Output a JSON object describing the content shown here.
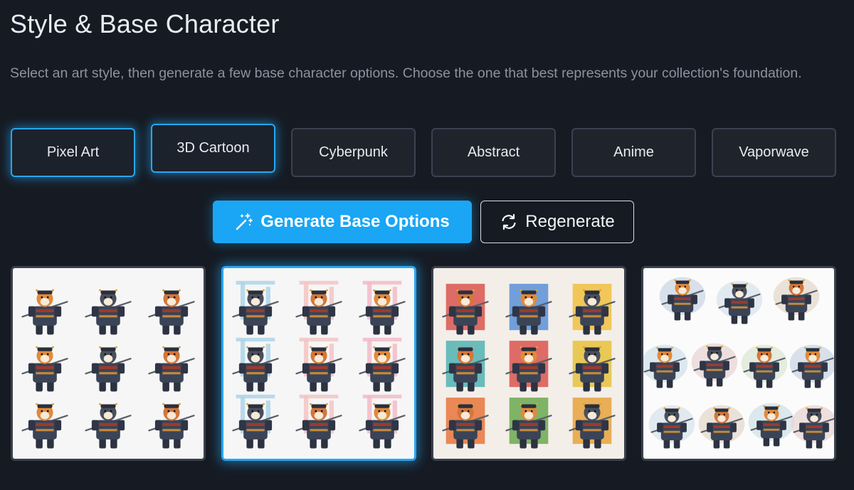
{
  "header": {
    "title": "Style & Base Character",
    "description": "Select an art style, then generate a few base character options. Choose the one that best represents your collection's foundation."
  },
  "styles": [
    {
      "label": "Pixel Art",
      "active": true
    },
    {
      "label": "3D Cartoon",
      "active": true
    },
    {
      "label": "Cyberpunk",
      "active": false
    },
    {
      "label": "Abstract",
      "active": false
    },
    {
      "label": "Anime",
      "active": false
    },
    {
      "label": "Vaporwave",
      "active": false
    }
  ],
  "actions": {
    "generate_label": "Generate Base Options",
    "generate_icon": "magic-wand-icon",
    "regenerate_label": "Regenerate",
    "regenerate_icon": "refresh-icon"
  },
  "options": [
    {
      "name": "base-option-1",
      "selected": false,
      "backdrop": "plain",
      "image": "3x3 grid of samurai shiba characters"
    },
    {
      "name": "base-option-2",
      "selected": true,
      "backdrop": "japanese-landmarks",
      "image": "3x3 grid of samurai shiba characters"
    },
    {
      "name": "base-option-3",
      "selected": false,
      "backdrop": "color-blocks",
      "image": "3x3 grid of samurai shiba characters"
    },
    {
      "name": "base-option-4",
      "selected": false,
      "backdrop": "watercolor",
      "image": "grid of samurai shiba characters"
    }
  ],
  "colors": {
    "background": "#161b23",
    "accent": "#1aa6f4",
    "button_bg": "#1f242c",
    "border": "#3b4150"
  }
}
